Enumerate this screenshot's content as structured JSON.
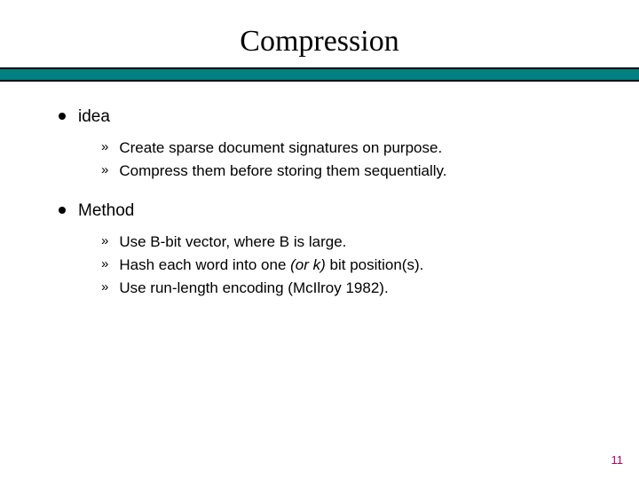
{
  "title": "Compression",
  "bullets": {
    "0": {
      "label": "idea",
      "sub": {
        "0": "Create sparse document signatures on purpose.",
        "1": "Compress them before storing them sequentially."
      }
    },
    "1": {
      "label": "Method",
      "sub": {
        "0": "Use B-bit vector, where B is large.",
        "1_pre": "Hash each word into one ",
        "1_ital": "(or k)",
        "1_post": " bit position(s).",
        "2": "Use run-length encoding (McIlroy 1982)."
      }
    }
  },
  "page_number": "11",
  "chevron": "»"
}
